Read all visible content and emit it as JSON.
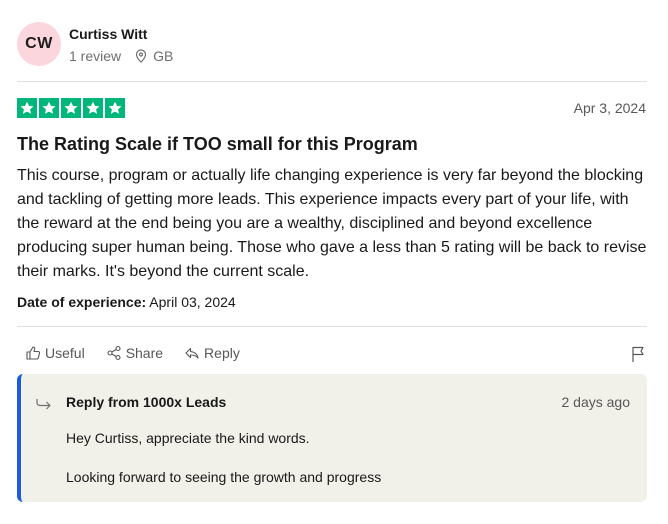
{
  "consumer": {
    "initials": "CW",
    "name": "Curtiss Witt",
    "reviews": "1 review",
    "country": "GB",
    "avatar_color": "#fbd7dd"
  },
  "review": {
    "rating": 5,
    "rating_max": 5,
    "star_color": "#00b67a",
    "date": "Apr 3, 2024",
    "title": "The Rating Scale if TOO small for this Program",
    "body": "This course, program or actually life changing experience is very far beyond the blocking and tackling of getting more leads. This experience impacts every part of your life, with the reward at the end being you are a wealthy, disciplined and beyond excellence producing super human being. Those who gave a less than 5 rating will be back to revise their marks. It's beyond the current scale.",
    "experience_label": "Date of experience:",
    "experience_date": "April 03, 2024"
  },
  "actions": {
    "useful": "Useful",
    "share": "Share",
    "reply": "Reply",
    "icons": [
      "thumbs-up-icon",
      "share-icon",
      "reply-arrow-icon",
      "flag-icon"
    ]
  },
  "company_reply": {
    "from": "Reply from 1000x Leads",
    "time": "2 days ago",
    "line1": "Hey Curtiss, appreciate the kind words.",
    "line2": "Looking forward to seeing the growth and progress",
    "accent_color": "#1c5bd9",
    "background": "#f1f0e9"
  }
}
